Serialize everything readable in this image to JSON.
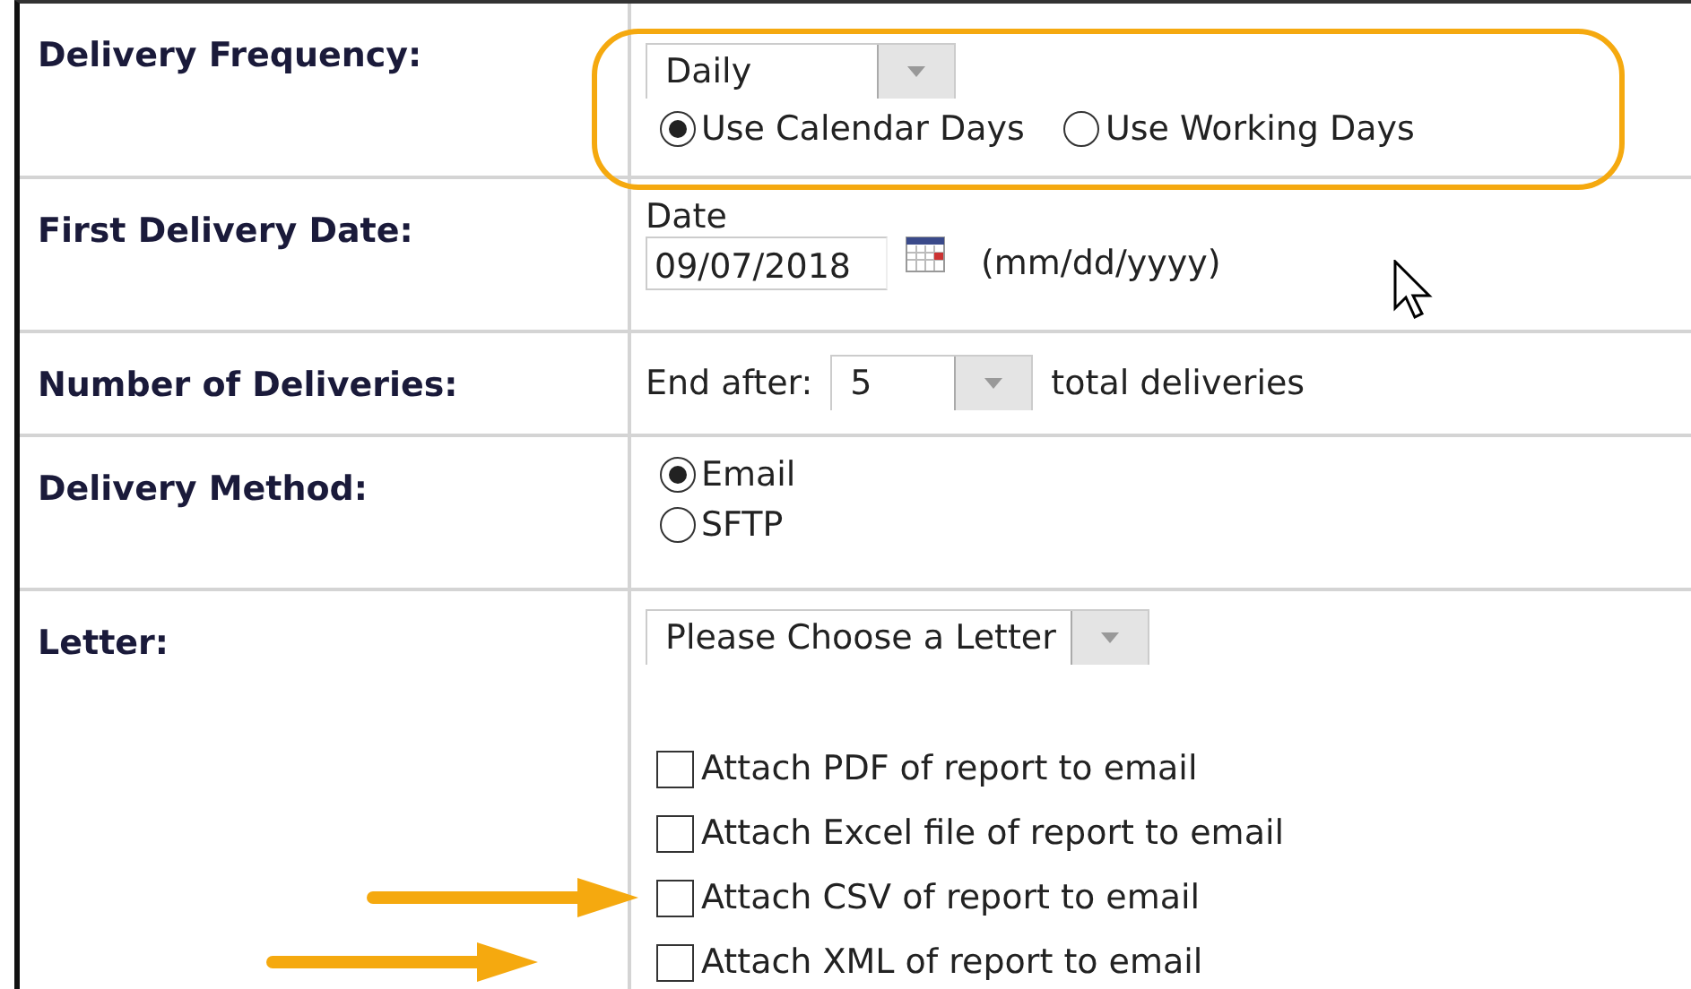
{
  "form": {
    "rows": [
      {
        "kind": "frequency",
        "label": "Delivery Frequency:",
        "select": "Daily",
        "highlighted": true,
        "radios": [
          {
            "label": "Use Calendar Days",
            "selected": true
          },
          {
            "label": "Use Working Days",
            "selected": false
          }
        ]
      },
      {
        "kind": "date",
        "label": "First Delivery Date:",
        "caption": "Date",
        "value": "09/07/2018",
        "hint": "(mm/dd/yyyy)"
      },
      {
        "kind": "count",
        "label": "Number of Deliveries:",
        "prefix": "End after:",
        "select": "5",
        "suffix": "total deliveries"
      },
      {
        "kind": "method",
        "label": "Delivery Method:",
        "radios": [
          {
            "label": "Email",
            "selected": true
          },
          {
            "label": "SFTP",
            "selected": false
          }
        ]
      },
      {
        "kind": "letter",
        "label": "Letter:",
        "select": "Please Choose a Letter",
        "options": [
          {
            "label": "Attach PDF of report to email",
            "checked": false,
            "arrow": false
          },
          {
            "label": "Attach Excel file of report to email",
            "checked": false,
            "arrow": false
          },
          {
            "label": "Attach CSV of report to email",
            "checked": false,
            "arrow": true
          },
          {
            "label": "Attach XML of report to email",
            "checked": false,
            "arrow": true
          }
        ]
      }
    ]
  }
}
